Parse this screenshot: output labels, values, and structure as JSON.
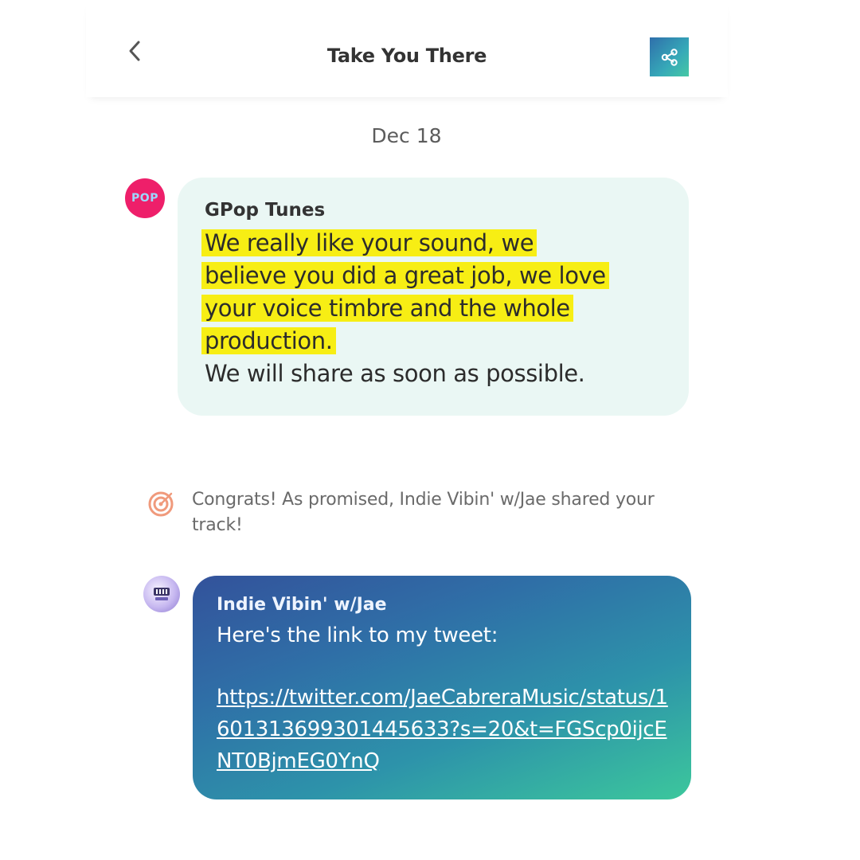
{
  "header": {
    "title": "Take You There",
    "back_icon": "chevron-left-icon",
    "share_icon": "share-icon",
    "share_gradient": [
      "#2f6fab",
      "#45c8a4"
    ]
  },
  "thread": {
    "date": "Dec 18",
    "messages": [
      {
        "sender": "GPop Tunes",
        "avatar_color": "#ee1f6a",
        "avatar_logo_text": "POP",
        "highlight_lines": [
          "We really like your sound, we",
          "believe you did a great job, we love",
          "your voice timbre and the whole",
          "production. "
        ],
        "highlight_color": "#f7ee14",
        "plain_text": "We will share as soon as possible.",
        "bubble_color": "#eaf7f4"
      },
      {
        "notice_icon": "target-icon",
        "notice_text": "Congrats! As promised, Indie Vibin' w/Jae shared your track!"
      },
      {
        "sender": "Indie Vibin' w/Jae",
        "text": "Here's the link to my tweet:",
        "link": "https://twitter.com/JaeCabreraMusic/status/1601313699301445633?s=20&t=FGScp0ijcENT0BjmEG0YnQ",
        "bubble_gradient": [
          "#33529b",
          "#3cc79c"
        ]
      }
    ]
  }
}
